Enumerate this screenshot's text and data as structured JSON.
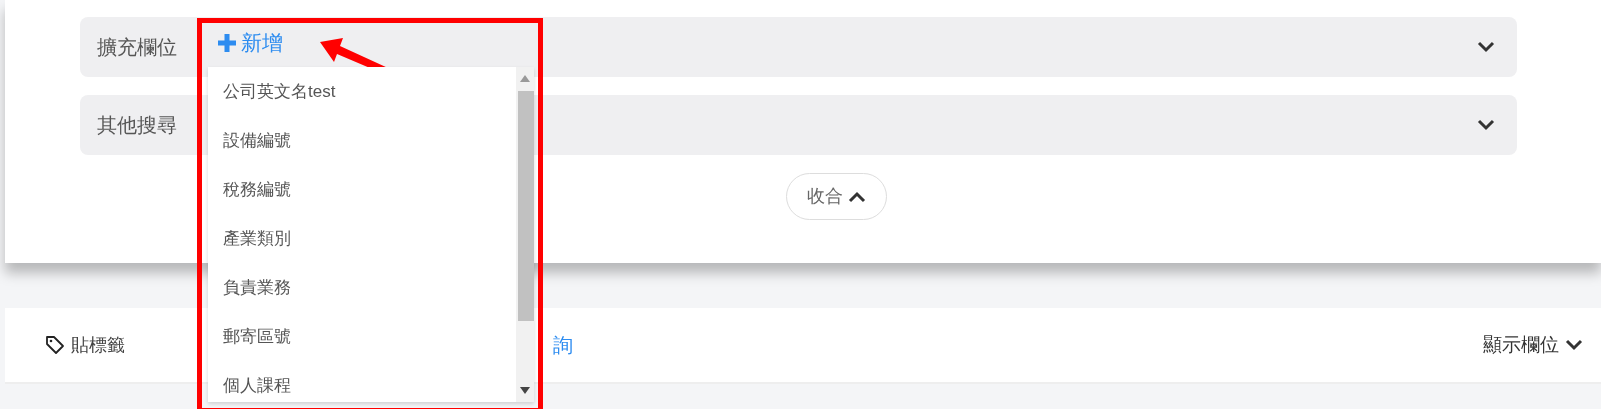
{
  "filter_panel": {
    "sections": [
      {
        "label": "擴充欄位",
        "expanded": false
      },
      {
        "label": "其他搜尋",
        "expanded": false
      }
    ],
    "collapse_button": "收合"
  },
  "toolbar": {
    "tag_button": "貼標籤",
    "query_link": "詢",
    "columns_button": "顯示欄位"
  },
  "popup": {
    "add_button": "新增",
    "items": [
      "公司英文名test",
      "設備編號",
      "稅務編號",
      "產業類別",
      "負責業務",
      "郵寄區號",
      "個人課程"
    ]
  }
}
